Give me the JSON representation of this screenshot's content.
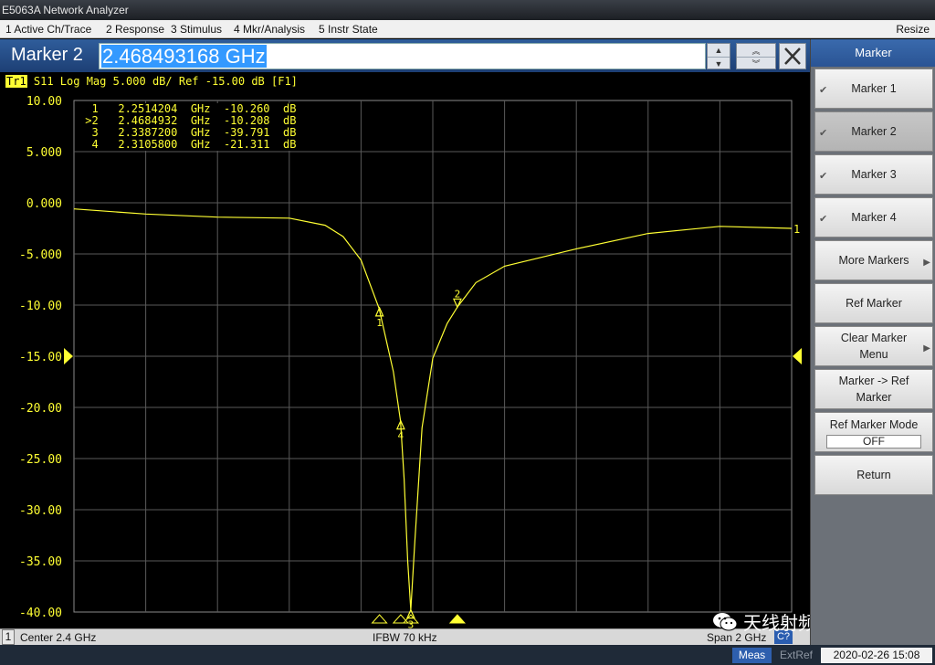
{
  "window": {
    "title": "E5063A Network Analyzer"
  },
  "menu": {
    "items": [
      "1 Active Ch/Trace",
      "2 Response",
      "3 Stimulus",
      "4 Mkr/Analysis",
      "5 Instr State"
    ],
    "resize": "Resize"
  },
  "entry": {
    "label": "Marker 2",
    "value": "2.468493168 GHz"
  },
  "trace_header": {
    "trace_id": "Tr1",
    "text": " S11 Log Mag 5.000 dB/ Ref -15.00 dB [F1]"
  },
  "markers": [
    {
      "row": "  1   2.2514204  GHz  -10.260  dB"
    },
    {
      "row": " >2   2.4684932  GHz  -10.208  dB"
    },
    {
      "row": "  3   2.3387200  GHz  -39.791  dB"
    },
    {
      "row": "  4   2.3105800  GHz  -21.311  dB"
    }
  ],
  "chart_data": {
    "type": "line",
    "ylabel": "",
    "xlabel": "",
    "ylim": [
      -40,
      10
    ],
    "ytick_labels": [
      "10.00",
      "5.000",
      "0.000",
      "-5.000",
      "-10.00",
      "-15.00",
      "-20.00",
      "-25.00",
      "-30.00",
      "-35.00",
      "-40.00"
    ],
    "xlim_ghz": [
      1.4,
      3.4
    ],
    "reference_level": "-15.00",
    "grid": true,
    "series": [
      {
        "x": [
          1.4,
          1.6,
          1.8,
          2.0,
          2.1,
          2.15,
          2.2,
          2.25,
          2.29,
          2.31,
          2.32,
          2.33,
          2.3387,
          2.35,
          2.37,
          2.4,
          2.44,
          2.4685,
          2.52,
          2.6,
          2.8,
          3.0,
          3.2,
          3.4
        ],
        "values": [
          -0.6,
          -1.1,
          -1.4,
          -1.5,
          -2.2,
          -3.3,
          -5.6,
          -10.3,
          -16.5,
          -21.3,
          -27.0,
          -35.0,
          -39.8,
          -33.0,
          -22.0,
          -15.2,
          -11.8,
          -10.2,
          -7.8,
          -6.2,
          -4.5,
          -3.0,
          -2.3,
          -2.5
        ]
      }
    ],
    "marker_points": [
      {
        "label": "1",
        "x": 2.2514204,
        "y": -10.26
      },
      {
        "label": "2",
        "x": 2.4684932,
        "y": -10.208
      },
      {
        "label": "3",
        "x": 2.33872,
        "y": -39.791
      },
      {
        "label": "4",
        "x": 2.31058,
        "y": -21.311
      }
    ],
    "trace_end_label": "1"
  },
  "channel_status": {
    "channel": "1",
    "center": "Center  2.4 GHz",
    "ifbw": "IFBW 70 kHz",
    "span": "Span 2 GHz",
    "badge": "C?"
  },
  "softkeys": {
    "title": "Marker",
    "keys": [
      {
        "label": "Marker 1",
        "checked": true
      },
      {
        "label": "Marker 2",
        "checked": true,
        "active": true
      },
      {
        "label": "Marker 3",
        "checked": true
      },
      {
        "label": "Marker 4",
        "checked": true
      },
      {
        "label": "More Markers",
        "submenu": true
      },
      {
        "label": "Ref Marker"
      },
      {
        "label": "Clear Marker Menu",
        "submenu": true
      },
      {
        "label": "Marker -> Ref Marker"
      },
      {
        "label": "Ref Marker Mode",
        "value": "OFF"
      },
      {
        "label": "Return"
      }
    ]
  },
  "status_bar": {
    "meas": "Meas",
    "extref": "ExtRef",
    "datetime": "2020-02-26 15:08"
  },
  "watermark": {
    "text": "天线射频加油站"
  },
  "colors": {
    "trace": "#ffff33",
    "grid": "#5a5a5a",
    "accent": "#2e5fae"
  }
}
